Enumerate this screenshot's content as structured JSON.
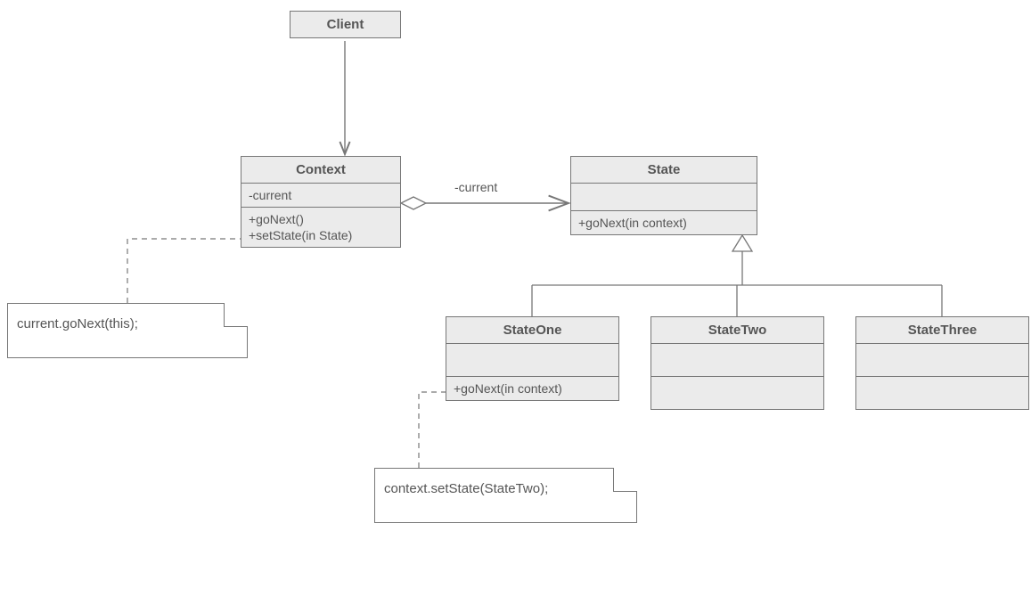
{
  "diagram": {
    "client": {
      "title": "Client"
    },
    "context": {
      "title": "Context",
      "attr1": "-current",
      "op1": "+goNext()",
      "op2": "+setState(in State)"
    },
    "state": {
      "title": "State",
      "op1": "+goNext(in context)"
    },
    "stateOne": {
      "title": "StateOne",
      "op1": "+goNext(in context)"
    },
    "stateTwo": {
      "title": "StateTwo"
    },
    "stateThree": {
      "title": "StateThree"
    },
    "assocLabel": "-current",
    "note1": "current.goNext(this);",
    "note2": "context.setState(StateTwo);"
  }
}
